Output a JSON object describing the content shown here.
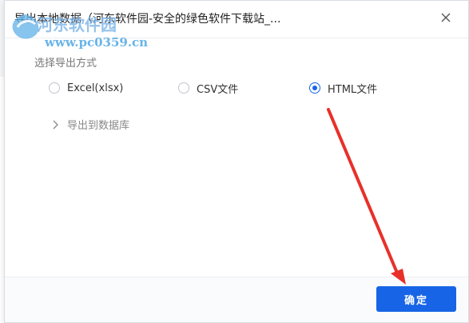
{
  "dialog": {
    "title": "导出本地数据（河东软件园-安全的绿色软件下载站_..."
  },
  "export_mode": {
    "label": "选择导出方式",
    "options": [
      {
        "label": "Excel(xlsx)",
        "checked": false
      },
      {
        "label": "CSV文件",
        "checked": false
      },
      {
        "label": "HTML文件",
        "checked": true
      }
    ]
  },
  "database": {
    "label": "导出到数据库"
  },
  "footer": {
    "ok_label": "确定"
  },
  "watermark": {
    "site_name": "河东软件园",
    "url": "www.pc0359.cn"
  },
  "colors": {
    "accent": "#1765e6",
    "annotation_arrow": "#e8302a"
  }
}
